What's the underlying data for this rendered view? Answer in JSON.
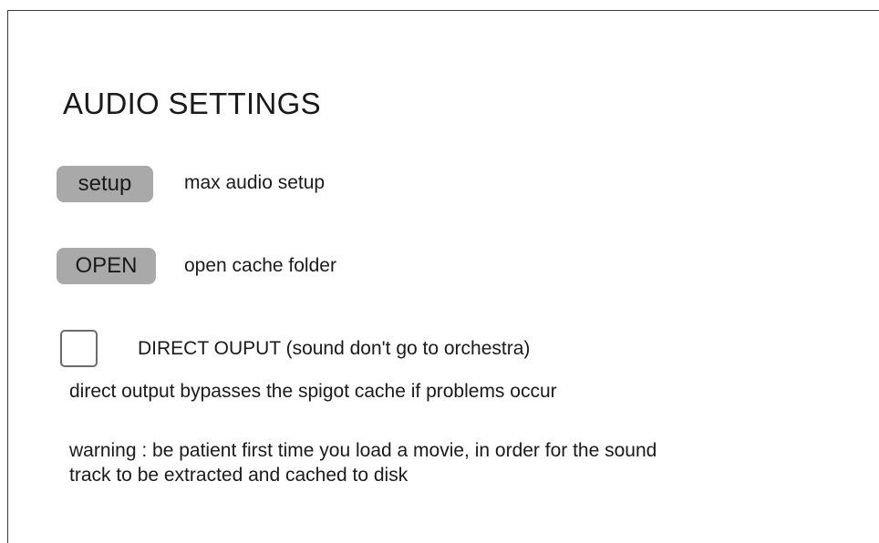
{
  "title": "AUDIO SETTINGS",
  "setup": {
    "button_label": "setup",
    "description": "max audio setup"
  },
  "open": {
    "button_label": "OPEN",
    "description": "open cache folder"
  },
  "direct_output": {
    "checked": false,
    "label": "DIRECT OUPUT (sound don't go to orchestra)",
    "note": "direct output bypasses the spigot cache if problems occur"
  },
  "warning": {
    "line1": "warning : be patient first time you load a movie, in order for the sound",
    "line2": "track to be extracted and cached to disk"
  },
  "colors": {
    "button_bg": "#a9a9a9",
    "border": "#3a3a3a",
    "text": "#1a1a1a"
  }
}
